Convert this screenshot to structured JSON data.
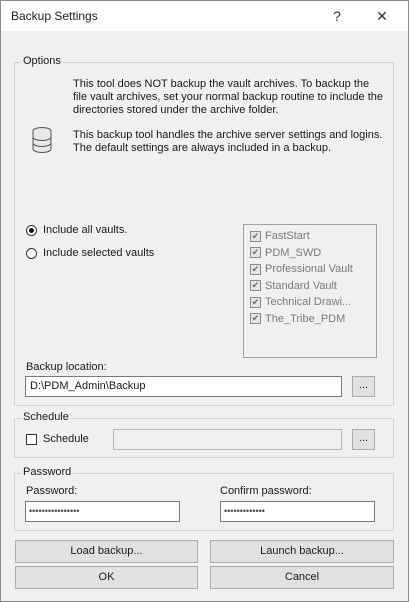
{
  "window": {
    "title": "Backup Settings",
    "help_glyph": "?",
    "close_glyph": "✕"
  },
  "options": {
    "legend": "Options",
    "info_text_1": "This tool does NOT backup the vault archives. To backup the file vault archives, set your normal backup routine to include the directories stored under the archive folder.",
    "info_text_2": "This backup tool handles the archive server settings and logins. The default settings are always included in a backup.",
    "radio_all": {
      "label": "Include all vaults.",
      "selected": true
    },
    "radio_selected": {
      "label": "Include selected vaults",
      "selected": false
    },
    "vaults": [
      {
        "label": "FastStart",
        "checked": true
      },
      {
        "label": "PDM_SWD",
        "checked": true
      },
      {
        "label": "Professional Vault",
        "checked": true
      },
      {
        "label": "Standard Vault",
        "checked": true
      },
      {
        "label": "Technical Drawi...",
        "checked": true
      },
      {
        "label": "The_Tribe_PDM",
        "checked": true
      }
    ],
    "backup_location_label": "Backup location:",
    "backup_location_value": "D:\\PDM_Admin\\Backup",
    "browse_label": "..."
  },
  "schedule": {
    "legend": "Schedule",
    "checkbox_label": "Schedule",
    "checked": false,
    "value": "",
    "browse_label": "..."
  },
  "password": {
    "legend": "Password",
    "password_label": "Password:",
    "password_mask": "••••••••••••••••",
    "confirm_label": "Confirm password:",
    "confirm_mask": "•••••••••••••"
  },
  "buttons": {
    "load_backup": "Load backup...",
    "launch_backup": "Launch backup...",
    "ok": "OK",
    "cancel": "Cancel"
  }
}
